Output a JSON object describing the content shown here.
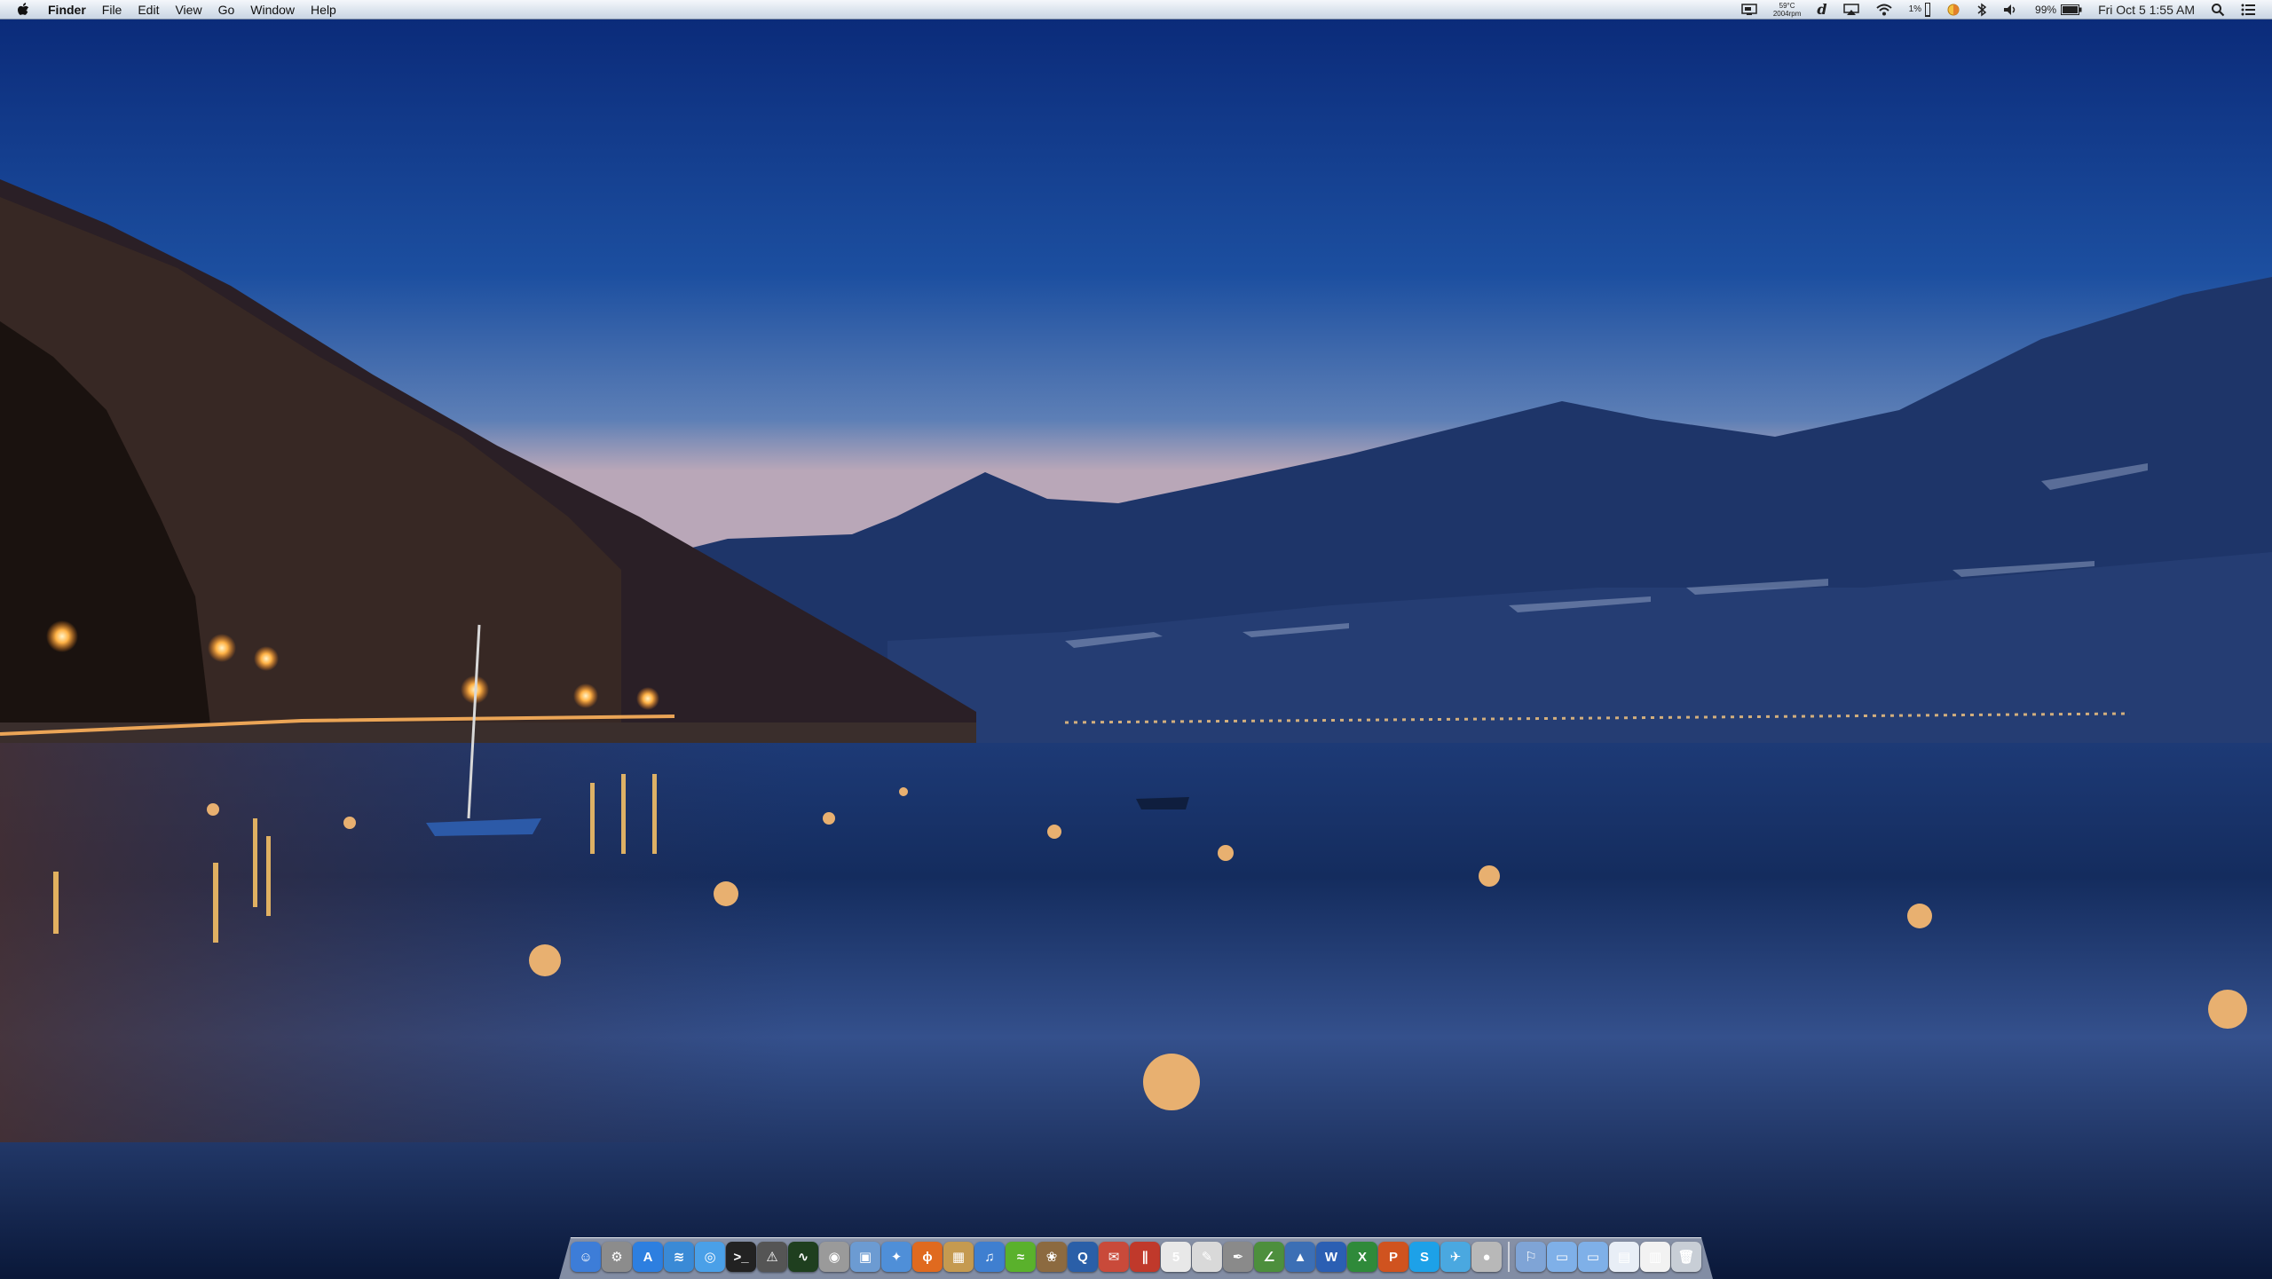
{
  "menubar": {
    "app_name": "Finder",
    "menus": [
      "File",
      "Edit",
      "View",
      "Go",
      "Window",
      "Help"
    ],
    "status": {
      "temp": "59°C",
      "fan": "2004rpm",
      "cpu": "1%",
      "battery": "99%",
      "clock": "Fri Oct 5  1:55 AM"
    }
  },
  "dock": {
    "apps": [
      {
        "name": "finder-icon",
        "color": "#3d7dd8",
        "glyph": "☺"
      },
      {
        "name": "system-preferences-icon",
        "color": "#8c8c8c",
        "glyph": "⚙"
      },
      {
        "name": "app-store-icon",
        "color": "#2d7fe0",
        "glyph": "A"
      },
      {
        "name": "rss-reader-icon",
        "color": "#3a8ad6",
        "glyph": "≋"
      },
      {
        "name": "safari-icon",
        "color": "#4aa0e8",
        "glyph": "◎"
      },
      {
        "name": "terminal-icon",
        "color": "#222222",
        "glyph": ">_"
      },
      {
        "name": "console-icon",
        "color": "#555555",
        "glyph": "⚠"
      },
      {
        "name": "activity-monitor-icon",
        "color": "#1f3f1f",
        "glyph": "∿"
      },
      {
        "name": "disk-utility-icon",
        "color": "#9a9a9a",
        "glyph": "◉"
      },
      {
        "name": "preview-icon",
        "color": "#6c9bd2",
        "glyph": "▣"
      },
      {
        "name": "safari-compass-icon",
        "color": "#4f8fd8",
        "glyph": "✦"
      },
      {
        "name": "firefox-icon",
        "color": "#e06a1f",
        "glyph": "ϕ"
      },
      {
        "name": "package-icon",
        "color": "#c59a50",
        "glyph": "▦"
      },
      {
        "name": "itunes-icon",
        "color": "#3f7fd0",
        "glyph": "♫"
      },
      {
        "name": "spotify-icon",
        "color": "#5ab12c",
        "glyph": "≈"
      },
      {
        "name": "iphoto-icon",
        "color": "#8c6a40",
        "glyph": "❀"
      },
      {
        "name": "quicktime-icon",
        "color": "#2a5fa8",
        "glyph": "Q"
      },
      {
        "name": "mail-stamp-icon",
        "color": "#c94a3a",
        "glyph": "✉"
      },
      {
        "name": "parallels-icon",
        "color": "#c0392b",
        "glyph": "∥"
      },
      {
        "name": "calendar-icon",
        "color": "#e8e8e8",
        "glyph": "5"
      },
      {
        "name": "textedit-icon",
        "color": "#d9d9d9",
        "glyph": "✎"
      },
      {
        "name": "script-editor-icon",
        "color": "#8a8a8a",
        "glyph": "✒"
      },
      {
        "name": "grapher-icon",
        "color": "#4d8f3d",
        "glyph": "∠"
      },
      {
        "name": "keynote-icon",
        "color": "#3c6fb5",
        "glyph": "▲"
      },
      {
        "name": "word-icon",
        "color": "#2b5fb3",
        "glyph": "W"
      },
      {
        "name": "excel-icon",
        "color": "#2f8a3a",
        "glyph": "X"
      },
      {
        "name": "powerpoint-icon",
        "color": "#d0531f",
        "glyph": "P"
      },
      {
        "name": "skype-icon",
        "color": "#1da1e8",
        "glyph": "S"
      },
      {
        "name": "twitter-icon",
        "color": "#4aa8e0",
        "glyph": "✈"
      },
      {
        "name": "mic-icon",
        "color": "#b8b8b8",
        "glyph": "●"
      }
    ],
    "stacks": [
      {
        "name": "network-icon",
        "color": "#7fa4d6",
        "glyph": "⚐"
      },
      {
        "name": "applications-folder-icon",
        "color": "#7fb0e8",
        "glyph": "▭"
      },
      {
        "name": "documents-folder-icon",
        "color": "#7fb0e8",
        "glyph": "▭"
      },
      {
        "name": "downloads-stack-icon",
        "color": "#e8eef6",
        "glyph": "▤"
      },
      {
        "name": "documents-stack-icon",
        "color": "#f2f2f2",
        "glyph": "▥"
      },
      {
        "name": "trash-icon",
        "color": "#c8ced6",
        "glyph": "🗑"
      }
    ]
  }
}
